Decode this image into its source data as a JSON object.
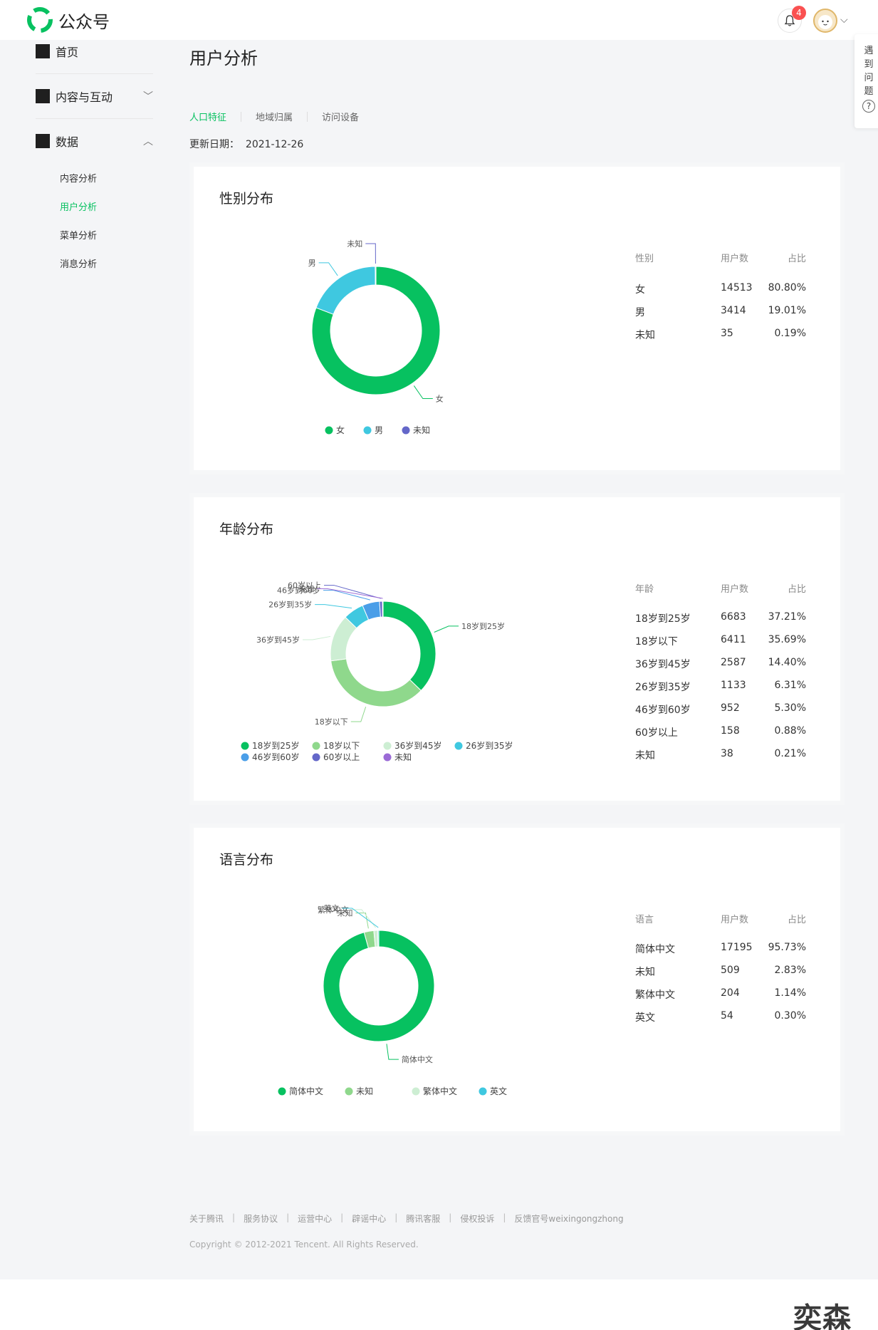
{
  "header": {
    "app_name": "公众号",
    "notification_count": "4",
    "brand_color": "#07c160"
  },
  "sidebar": {
    "home": "首页",
    "content": "内容与互动",
    "data": "数据",
    "sub_items": [
      "内容分析",
      "用户分析",
      "菜单分析",
      "消息分析"
    ],
    "active_sub": "用户分析"
  },
  "page": {
    "title": "用户分析",
    "tabs": [
      "人口特征",
      "地域归属",
      "访问设备"
    ],
    "active_tab": "人口特征",
    "update_label": "更新日期：",
    "update_date": "2021-12-26"
  },
  "help": {
    "chars": [
      "遇",
      "到",
      "问",
      "题"
    ],
    "icon": "?"
  },
  "cards": [
    {
      "title": "性别分布",
      "headers": [
        "性别",
        "用户数",
        "占比"
      ],
      "rows": [
        [
          "女",
          "14513",
          "80.80%"
        ],
        [
          "男",
          "3414",
          "19.01%"
        ],
        [
          "未知",
          "35",
          "0.19%"
        ]
      ]
    },
    {
      "title": "年龄分布",
      "headers": [
        "年龄",
        "用户数",
        "占比"
      ],
      "rows": [
        [
          "18岁到25岁",
          "6683",
          "37.21%"
        ],
        [
          "18岁以下",
          "6411",
          "35.69%"
        ],
        [
          "36岁到45岁",
          "2587",
          "14.40%"
        ],
        [
          "26岁到35岁",
          "1133",
          "6.31%"
        ],
        [
          "46岁到60岁",
          "952",
          "5.30%"
        ],
        [
          "60岁以上",
          "158",
          "0.88%"
        ],
        [
          "未知",
          "38",
          "0.21%"
        ]
      ]
    },
    {
      "title": "语言分布",
      "headers": [
        "语言",
        "用户数",
        "占比"
      ],
      "rows": [
        [
          "简体中文",
          "17195",
          "95.73%"
        ],
        [
          "未知",
          "509",
          "2.83%"
        ],
        [
          "繁体中文",
          "204",
          "1.14%"
        ],
        [
          "英文",
          "54",
          "0.30%"
        ]
      ]
    }
  ],
  "chart_data": [
    {
      "type": "pie",
      "title": "性别分布",
      "categories": [
        "女",
        "男",
        "未知"
      ],
      "values": [
        14513,
        3414,
        35
      ],
      "colors": [
        "#07c160",
        "#3fc8e0",
        "#6467c9"
      ],
      "legend": "bottom"
    },
    {
      "type": "pie",
      "title": "年龄分布",
      "categories": [
        "18岁到25岁",
        "18岁以下",
        "36岁到45岁",
        "26岁到35岁",
        "46岁到60岁",
        "60岁以上",
        "未知"
      ],
      "values": [
        6683,
        6411,
        2587,
        1133,
        952,
        158,
        38
      ],
      "colors": [
        "#07c160",
        "#8fd88c",
        "#cdeed3",
        "#3fc8e0",
        "#4a9ee8",
        "#6467c9",
        "#9b6bd6"
      ],
      "legend": "bottom"
    },
    {
      "type": "pie",
      "title": "语言分布",
      "categories": [
        "简体中文",
        "未知",
        "繁体中文",
        "英文"
      ],
      "values": [
        17195,
        509,
        204,
        54
      ],
      "colors": [
        "#07c160",
        "#8fd88c",
        "#cdeed3",
        "#3fc8e0"
      ],
      "legend": "bottom"
    }
  ],
  "footer": {
    "links": [
      "关于腾讯",
      "服务协议",
      "运营中心",
      "辟谣中心",
      "腾讯客服",
      "侵权投诉",
      "反馈官号weixingongzhong"
    ],
    "copyright": "Copyright © 2012-2021 Tencent. All Rights Reserved."
  },
  "watermark": "奕森榕"
}
